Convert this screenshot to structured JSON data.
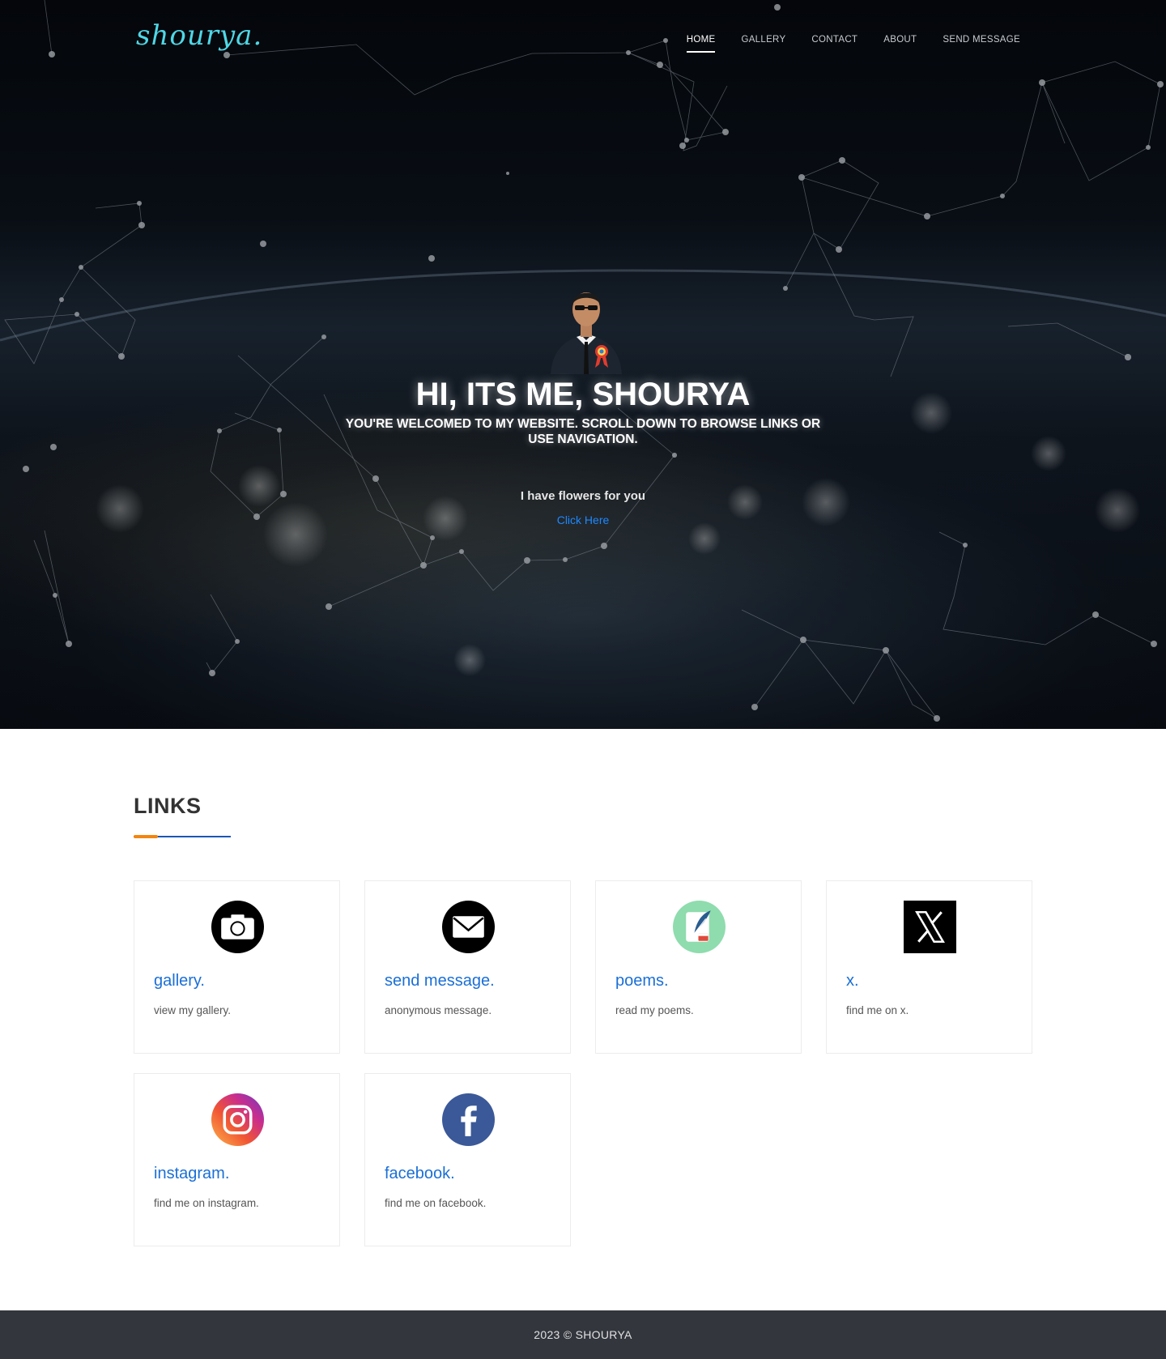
{
  "brand": {
    "logo_text": "shourya."
  },
  "nav": {
    "items": [
      {
        "label": "HOME",
        "active": true
      },
      {
        "label": "GALLERY",
        "active": false
      },
      {
        "label": "CONTACT",
        "active": false
      },
      {
        "label": "ABOUT",
        "active": false
      },
      {
        "label": "SEND MESSAGE",
        "active": false
      }
    ]
  },
  "hero": {
    "title": "HI, ITS ME, SHOURYA",
    "subtitle": "YOU'RE WELCOMED TO MY WEBSITE. SCROLL DOWN TO BROWSE LINKS OR USE NAVIGATION.",
    "flowers_text": "I have flowers for you",
    "click_link": "Click Here"
  },
  "links_section": {
    "heading": "LINKS",
    "cards": [
      {
        "title": "gallery.",
        "description": "view my gallery.",
        "icon": "camera-icon"
      },
      {
        "title": "send message.",
        "description": "anonymous message.",
        "icon": "envelope-icon"
      },
      {
        "title": "poems.",
        "description": "read my poems.",
        "icon": "quill-icon"
      },
      {
        "title": "x.",
        "description": "find me on x.",
        "icon": "x-logo-icon"
      },
      {
        "title": "instagram.",
        "description": "find me on instagram.",
        "icon": "instagram-icon"
      },
      {
        "title": "facebook.",
        "description": "find me on facebook.",
        "icon": "facebook-icon"
      }
    ]
  },
  "footer": {
    "text": "2023 © SHOURYA"
  },
  "colors": {
    "accent_blue": "#1a6fd6",
    "accent_orange": "#f3850f",
    "logo_cyan": "#4fd7e6",
    "footer_bg": "#33363d"
  }
}
